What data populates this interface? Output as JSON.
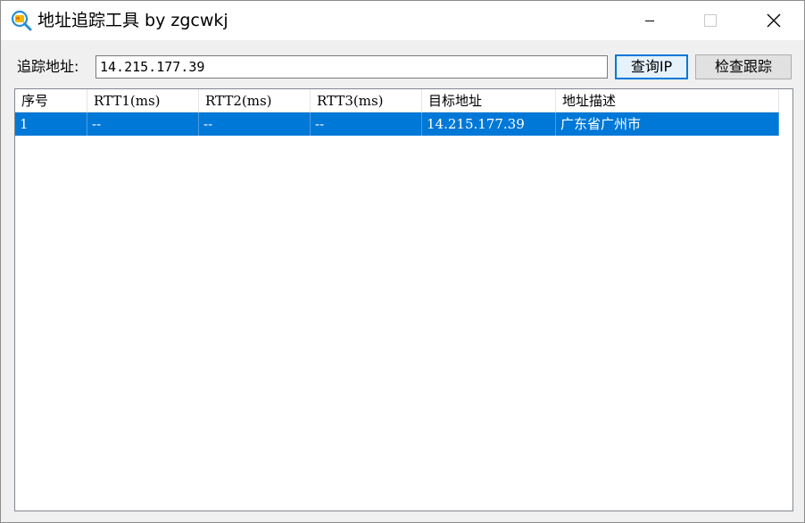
{
  "window": {
    "title": "地址追踪工具 by zgcwkj",
    "icon": "magnifier-globe-icon"
  },
  "toolbar": {
    "address_label": "追踪地址:",
    "address_value": "14.215.177.39",
    "query_button": "查询IP",
    "trace_button": "检查跟踪"
  },
  "table": {
    "columns": [
      "序号",
      "RTT1(ms)",
      "RTT2(ms)",
      "RTT3(ms)",
      "目标地址",
      "地址描述"
    ],
    "rows": [
      [
        "1",
        "--",
        "--",
        "--",
        "14.215.177.39",
        "广东省广州市"
      ]
    ],
    "selected_row": 0
  },
  "colors": {
    "selection": "#0078d7",
    "focus_border": "#0078d7",
    "window_bg": "#f0f0f0"
  }
}
